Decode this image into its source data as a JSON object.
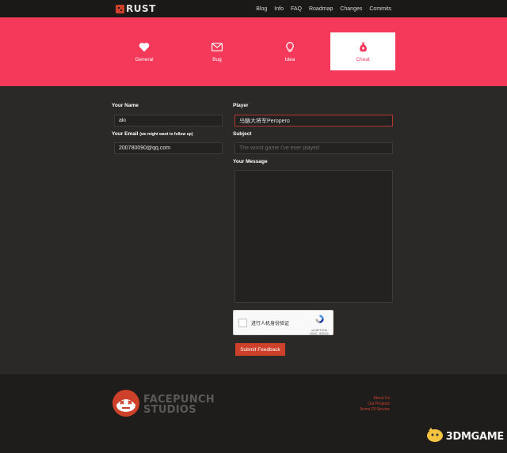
{
  "nav": {
    "logo_text": "RUST",
    "links": [
      "Blog",
      "Info",
      "FAQ",
      "Roadmap",
      "Changes",
      "Commits"
    ]
  },
  "categories": [
    {
      "label": "General",
      "icon": "heart-icon",
      "active": false
    },
    {
      "label": "Bug",
      "icon": "envelope-icon",
      "active": false
    },
    {
      "label": "Idea",
      "icon": "lightbulb-icon",
      "active": false
    },
    {
      "label": "Cheat",
      "icon": "money-bag-icon",
      "active": true
    }
  ],
  "form": {
    "name_label": "Your Name",
    "name_value": "aki",
    "email_label": "Your Email",
    "email_note": "(we might want to follow up)",
    "email_value": "200780090@qq.com",
    "player_label": "Player",
    "player_value": "乌鲢大将军Peropero",
    "subject_label": "Subject",
    "subject_placeholder": "The worst game I've ever played",
    "message_label": "Your Message",
    "message_value": "",
    "captcha_text": "进行人机身份验证",
    "captcha_brand": "reCAPTCHA",
    "captcha_links": "隐私权 - 使用条款",
    "submit_label": "Submit Feedback"
  },
  "footer": {
    "logo_line1": "FACEPUNCH",
    "logo_line2": "STUDIOS",
    "links": [
      "About Us",
      "Our Projects",
      "Terms Of Service"
    ]
  },
  "watermark": {
    "text": "3DMGAME"
  },
  "colors": {
    "accent": "#f5395b",
    "brand_red": "#cd412b",
    "background": "#2a2927"
  }
}
